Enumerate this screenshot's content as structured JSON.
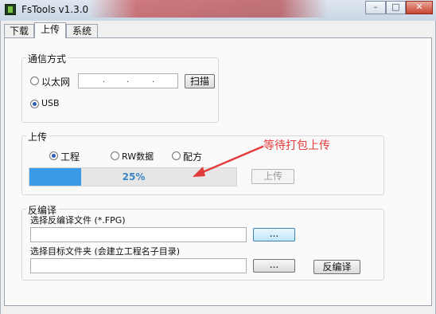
{
  "window": {
    "title": "FsTools v1.3.0",
    "minimize_glyph": "–",
    "maximize_glyph": "□",
    "close_glyph": "✕"
  },
  "tabs": [
    {
      "label": "下载",
      "active": false
    },
    {
      "label": "上传",
      "active": true
    },
    {
      "label": "系统",
      "active": false
    }
  ],
  "comm": {
    "group_label": "通信方式",
    "ethernet_label": "以太网",
    "ethernet_selected": false,
    "ip_dots": [
      ".",
      ".",
      "."
    ],
    "scan_button": "扫描",
    "usb_label": "USB",
    "usb_selected": true
  },
  "upload": {
    "group_label": "上传",
    "options": [
      {
        "label": "工程",
        "selected": true
      },
      {
        "label": "RW数据",
        "selected": false
      },
      {
        "label": "配方",
        "selected": false
      }
    ],
    "progress_percent": 25,
    "progress_text": "25%",
    "upload_button": "上传",
    "upload_button_enabled": false
  },
  "annotation": {
    "text": "等待打包上传",
    "color": "#e33b3b"
  },
  "decompile": {
    "group_label": "反编译",
    "file_label": "选择反编译文件 (*.FPG)",
    "file_value": "",
    "browse_file_button": "...",
    "folder_label": "选择目标文件夹 (会建立工程名子目录)",
    "folder_value": "",
    "browse_folder_button": "...",
    "decompile_button": "反编译"
  },
  "colors": {
    "progress_fill": "#3c9be8",
    "accent": "#2d5fb3"
  }
}
